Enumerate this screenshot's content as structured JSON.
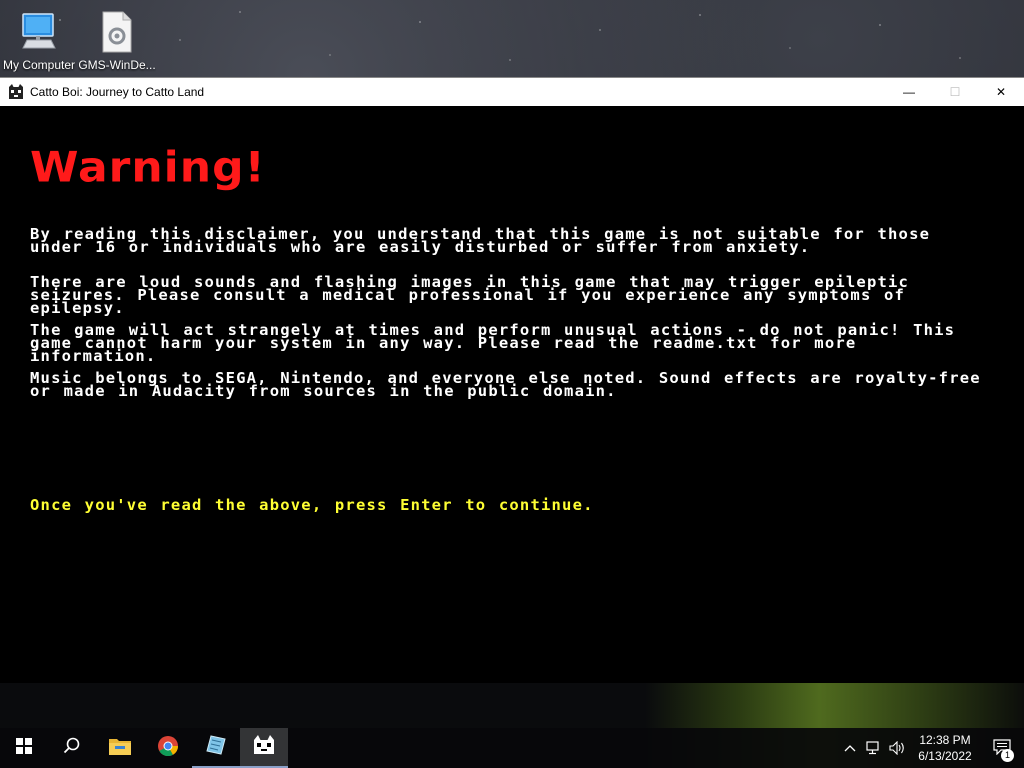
{
  "desktop": {
    "icons": [
      {
        "label": "My Computer",
        "icon": "computer-icon"
      },
      {
        "label": "GMS-WinDe...",
        "icon": "settings-file-icon"
      }
    ]
  },
  "window": {
    "title": "Catto Boi: Journey to Catto Land",
    "icon": "cat-icon",
    "controls": {
      "minimize": "—",
      "maximize": "☐",
      "close": "✕"
    }
  },
  "game": {
    "heading": "Warning!",
    "heading_color": "#ff1a1a",
    "paragraphs": [
      "By reading this disclaimer, you understand that this game is not suitable for those under 16 or individuals who are easily disturbed or suffer from anxiety.",
      "There are loud sounds and flashing images in this game that may trigger epileptic seizures. Please consult a medical professional if you experience any symptoms of epilepsy.",
      "The game will act strangely at times and perform unusual actions - do not panic! This game cannot harm your system in any way. Please read the readme.txt for more information.",
      "Music belongs to SEGA, Nintendo, and everyone else noted. Sound effects are royalty-free or made in Audacity from sources in the public domain."
    ],
    "prompt": "Once you've read the above, press Enter to continue.",
    "prompt_color": "#ffff33"
  },
  "taskbar": {
    "apps": [
      "start-icon",
      "search-icon",
      "file-explorer-icon",
      "chrome-icon",
      "notepad-icon",
      "catto-boi-icon"
    ],
    "tray": {
      "time": "12:38 PM",
      "date": "6/13/2022",
      "notifications": "1"
    }
  }
}
